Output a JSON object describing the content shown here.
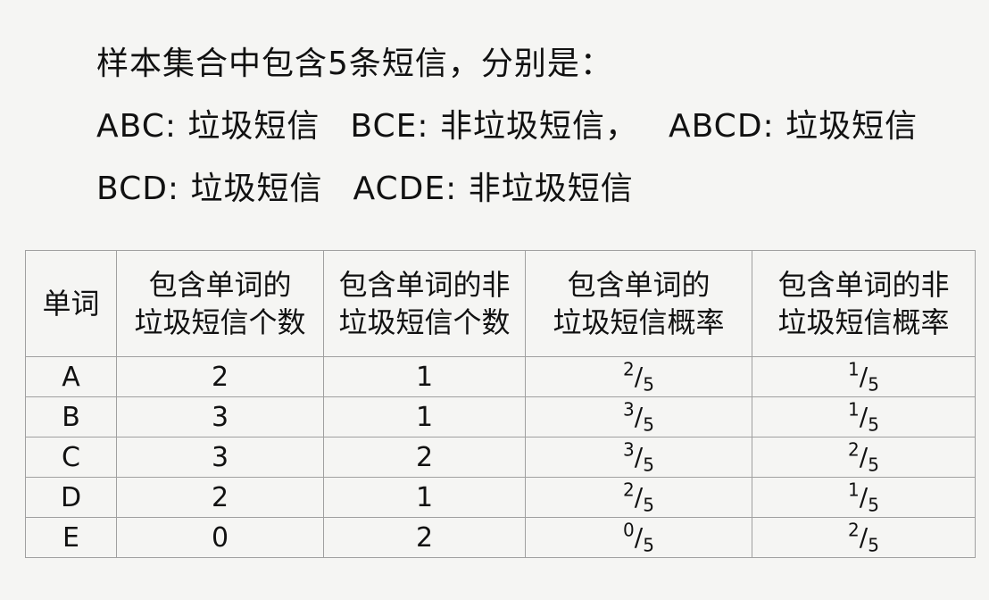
{
  "intro": "样本集合中包含5条短信，分别是：",
  "messages": [
    {
      "words": "ABC",
      "label": "垃圾短信"
    },
    {
      "words": "BCE",
      "label": "非垃圾短信"
    },
    {
      "words": "ABCD",
      "label": "垃圾短信"
    },
    {
      "words": "BCD",
      "label": "垃圾短信"
    },
    {
      "words": "ACDE",
      "label": "非垃圾短信"
    }
  ],
  "table": {
    "headers": [
      [
        "单词"
      ],
      [
        "包含单词的",
        "垃圾短信个数"
      ],
      [
        "包含单词的非",
        "垃圾短信个数"
      ],
      [
        "包含单词的",
        "垃圾短信概率"
      ],
      [
        "包含单词的非",
        "垃圾短信概率"
      ]
    ],
    "rows": [
      {
        "word": "A",
        "spam_count": "2",
        "ham_count": "1",
        "spam_prob": {
          "num": "2",
          "den": "5"
        },
        "ham_prob": {
          "num": "1",
          "den": "5"
        }
      },
      {
        "word": "B",
        "spam_count": "3",
        "ham_count": "1",
        "spam_prob": {
          "num": "3",
          "den": "5"
        },
        "ham_prob": {
          "num": "1",
          "den": "5"
        }
      },
      {
        "word": "C",
        "spam_count": "3",
        "ham_count": "2",
        "spam_prob": {
          "num": "3",
          "den": "5"
        },
        "ham_prob": {
          "num": "2",
          "den": "5"
        }
      },
      {
        "word": "D",
        "spam_count": "2",
        "ham_count": "1",
        "spam_prob": {
          "num": "2",
          "den": "5"
        },
        "ham_prob": {
          "num": "1",
          "den": "5"
        }
      },
      {
        "word": "E",
        "spam_count": "0",
        "ham_count": "2",
        "spam_prob": {
          "num": "0",
          "den": "5"
        },
        "ham_prob": {
          "num": "2",
          "den": "5"
        }
      }
    ]
  }
}
